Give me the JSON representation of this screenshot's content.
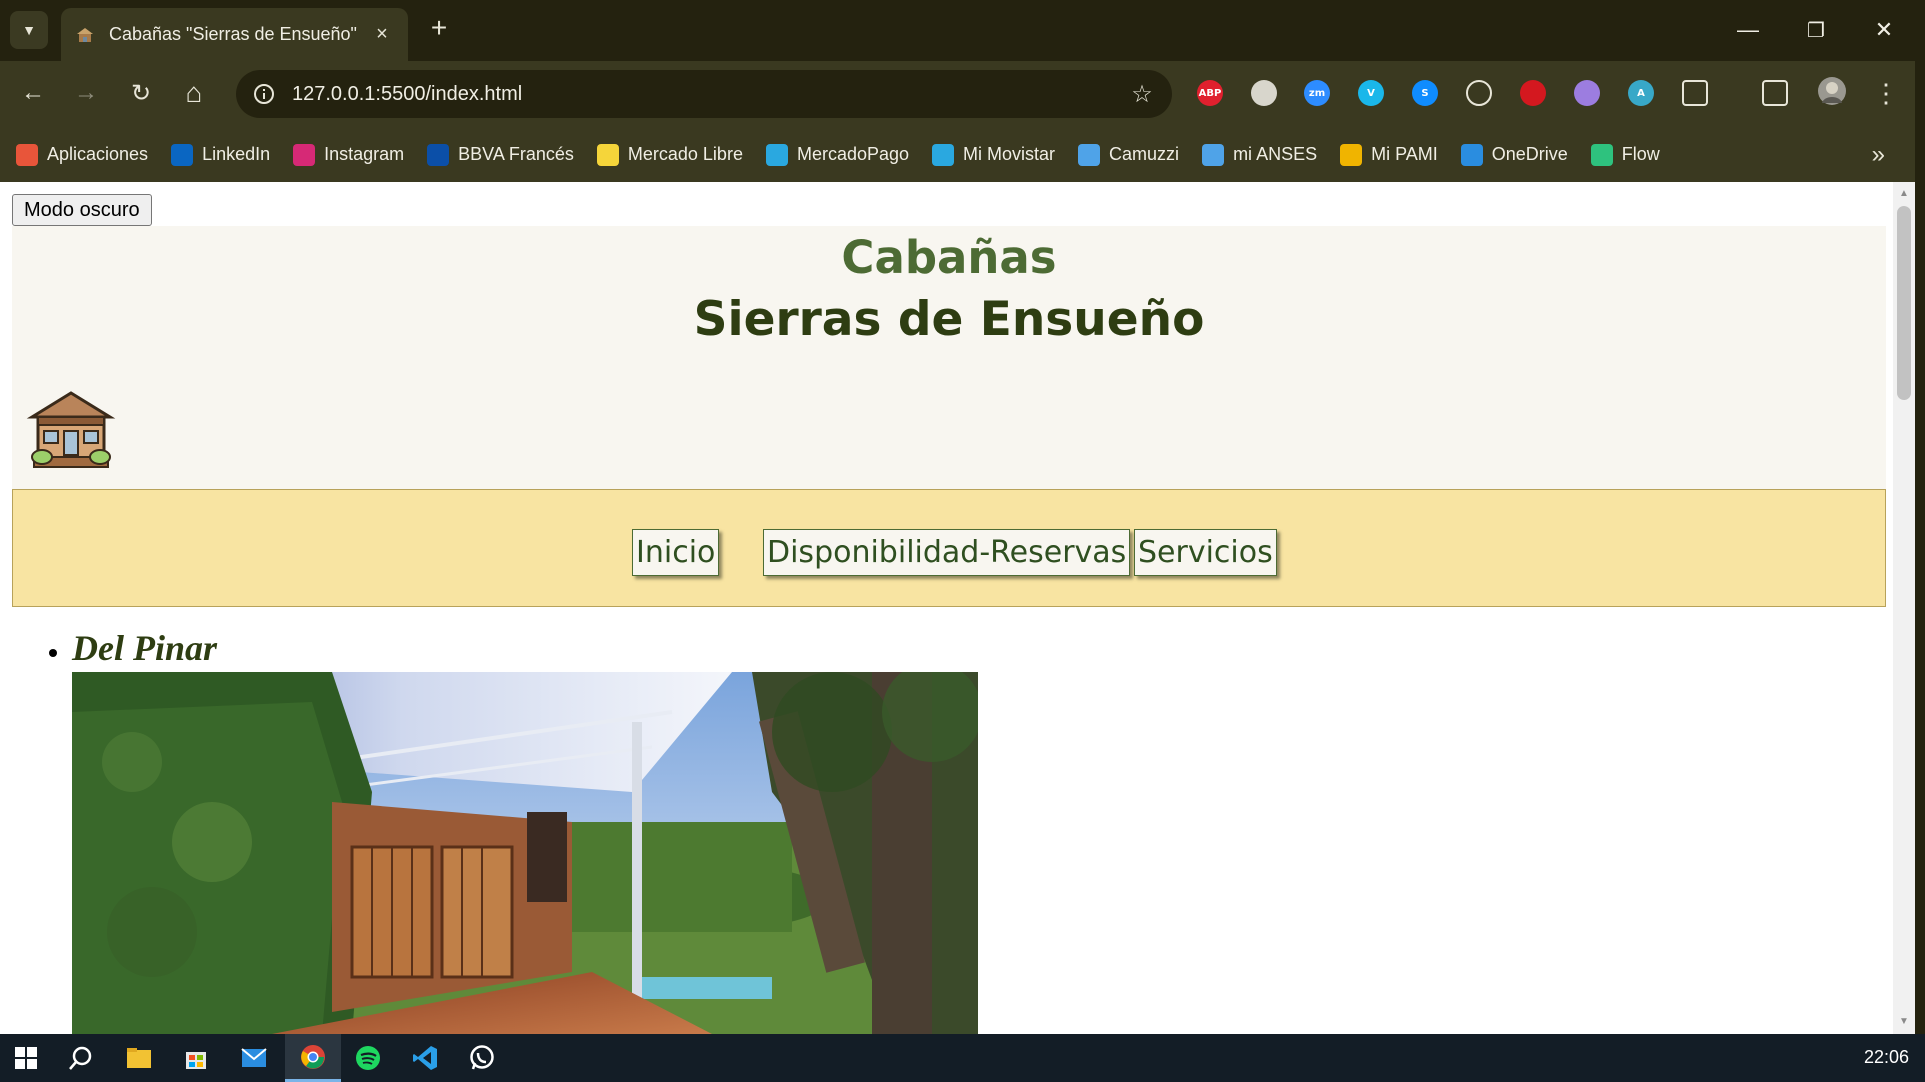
{
  "window": {
    "tab_title": "Cabañas \"Sierras de Ensueño\"",
    "tab_close": "×",
    "new_tab": "+",
    "minimize": "—",
    "restore": "❐",
    "close": "✕"
  },
  "toolbar": {
    "url": "127.0.0.1:5500/index.html",
    "back": "←",
    "forward": "→",
    "reload": "↻",
    "home": "⌂",
    "star": "☆",
    "menu": "⋮"
  },
  "extensions": [
    {
      "name": "adblock-plus-icon",
      "label": "ABP",
      "color": "#e0202e"
    },
    {
      "name": "printer-icon",
      "label": "",
      "color": "#d8d6cc"
    },
    {
      "name": "zoom-icon",
      "label": "zm",
      "color": "#2d8cff"
    },
    {
      "name": "vimeo-icon",
      "label": "V",
      "color": "#1ab7ea"
    },
    {
      "name": "shazam-icon",
      "label": "S",
      "color": "#0f8cff"
    },
    {
      "name": "react-devtools-icon",
      "label": "",
      "color": "#e8e6d8"
    },
    {
      "name": "pdf-icon",
      "label": "",
      "color": "#d4181f"
    },
    {
      "name": "drop-icon",
      "label": "",
      "color": "#9c7de0"
    },
    {
      "name": "translate-icon",
      "label": "A",
      "color": "#38a8c8"
    },
    {
      "name": "puzzle-extensions-icon",
      "label": "",
      "color": "#e8e6d8"
    },
    {
      "name": "cast-icon",
      "label": "",
      "color": "#e8e6d8"
    }
  ],
  "bookmarks": [
    {
      "label": "Aplicaciones",
      "icon": "apps-grid-icon",
      "color": "#e8553a"
    },
    {
      "label": "LinkedIn",
      "icon": "linkedin-icon",
      "color": "#0a66c2"
    },
    {
      "label": "Instagram",
      "icon": "instagram-icon",
      "color": "#d62976"
    },
    {
      "label": "BBVA Francés",
      "icon": "bbva-icon",
      "color": "#0b4fa8"
    },
    {
      "label": "Mercado Libre",
      "icon": "mercadolibre-icon",
      "color": "#f5d53a"
    },
    {
      "label": "MercadoPago",
      "icon": "mercadopago-icon",
      "color": "#2aa8e0"
    },
    {
      "label": "Mi Movistar",
      "icon": "movistar-icon",
      "color": "#2aa8e0"
    },
    {
      "label": "Camuzzi",
      "icon": "camuzzi-icon",
      "color": "#4fa3e8"
    },
    {
      "label": "mi ANSES",
      "icon": "anses-icon",
      "color": "#4fa3e8"
    },
    {
      "label": "Mi PAMI",
      "icon": "pami-icon",
      "color": "#f0b400"
    },
    {
      "label": "OneDrive",
      "icon": "onedrive-icon",
      "color": "#2a8de0"
    },
    {
      "label": "Flow",
      "icon": "flow-icon",
      "color": "#2ec27e"
    }
  ],
  "bookmarks_more": "»",
  "page": {
    "dark_mode_button": "Modo oscuro",
    "title_line1": "Cabañas",
    "title_line2": "Sierras de Ensueño",
    "nav": [
      "Inicio",
      "Disponibilidad-Reservas",
      "Servicios"
    ],
    "cabins": [
      {
        "name": "Del Pinar"
      }
    ]
  },
  "taskbar": {
    "clock": "22:06"
  }
}
